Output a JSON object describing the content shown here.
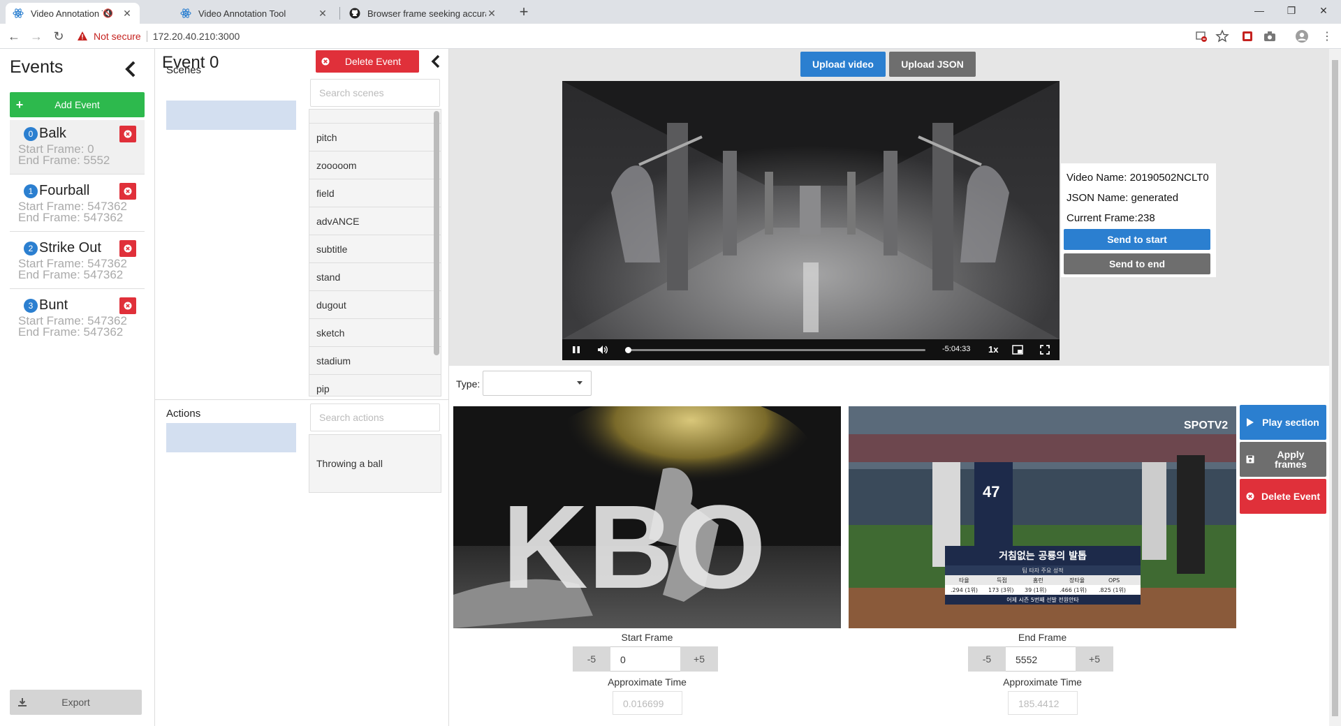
{
  "browser": {
    "tabs": [
      {
        "title": "Video Annotation Tool",
        "active": true,
        "muted": true
      },
      {
        "title": "Video Annotation Tool",
        "active": false
      },
      {
        "title": "Browser frame seeking accuracy",
        "active": false
      }
    ],
    "security_label": "Not secure",
    "url": "172.20.40.210:3000"
  },
  "sidebar": {
    "title": "Events",
    "add_label": "Add Event",
    "export_label": "Export",
    "events": [
      {
        "index": "0",
        "name": "Balk",
        "start": "Start Frame: 0",
        "end": "End Frame: 5552",
        "selected": true
      },
      {
        "index": "1",
        "name": "Fourball",
        "start": "Start Frame: 547362",
        "end": "End Frame: 547362",
        "selected": false
      },
      {
        "index": "2",
        "name": "Strike Out",
        "start": "Start Frame: 547362",
        "end": "End Frame: 547362",
        "selected": false
      },
      {
        "index": "3",
        "name": "Bunt",
        "start": "Start Frame: 547362",
        "end": "End Frame: 547362",
        "selected": false
      }
    ]
  },
  "editor": {
    "title": "Event 0",
    "delete_label": "Delete Event",
    "scenes_title": "Scenes",
    "scenes_search_placeholder": "Search scenes",
    "scenes": [
      "pitch",
      "zooooom",
      "field",
      "advANCE",
      "subtitle",
      "stand",
      "dugout",
      "sketch",
      "stadium",
      "pip"
    ],
    "actions_title": "Actions",
    "actions_search_placeholder": "Search actions",
    "actions": [
      "Throwing a ball"
    ]
  },
  "main": {
    "upload_video_label": "Upload video",
    "upload_json_label": "Upload JSON",
    "player": {
      "time_remaining": "-5:04:33",
      "speed": "1x",
      "progress": 0.005
    },
    "info": {
      "video_name": "Video Name: 20190502NCLT0",
      "json_name": "JSON Name: generated",
      "current_frame": "Current Frame:238",
      "send_start_label": "Send to start",
      "send_end_label": "Send to end"
    },
    "type_label": "Type:",
    "type_value": "",
    "start": {
      "caption": "Start Frame",
      "minus": "-5",
      "value": "0",
      "plus": "+5",
      "approx_caption": "Approximate Time",
      "approx_value": "0.016699"
    },
    "end": {
      "caption": "End Frame",
      "minus": "-5",
      "value": "5552",
      "plus": "+5",
      "approx_caption": "Approximate Time",
      "approx_value": "185.4412"
    },
    "end_frame_overlay": {
      "headline": "거침없는 공룡의 발톱",
      "sub": "팀 타자 주요 성적",
      "stat_headers": [
        "타율",
        "득점",
        "홈런",
        "장타율",
        "OPS"
      ],
      "stat_values": [
        ".294 (1위)",
        "173 (3위)",
        "39 (1위)",
        ".466 (1위)",
        ".825 (1위)"
      ],
      "footer": "어제 시즌 5번째 선발 전원안타",
      "player_number": "47",
      "broadcaster": "SPOTV2"
    },
    "start_frame_overlay": {
      "text": "KBO"
    },
    "play_section_label": "Play section",
    "apply_frames_label": "Apply frames",
    "delete_event_label": "Delete Event"
  },
  "colors": {
    "primary": "#2b7fd0",
    "success": "#2db94d",
    "danger": "#e0303a",
    "neutral": "#6e6e6e"
  }
}
